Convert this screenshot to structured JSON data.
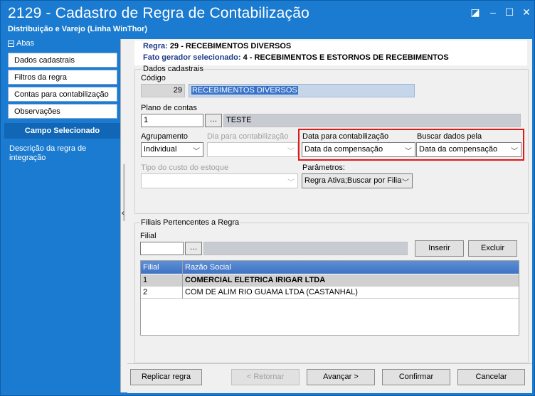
{
  "window": {
    "title": "2129 - Cadastro de Regra de Contabilização",
    "subtitle": "Distribuição e Varejo (Linha WinThor)",
    "controls": {
      "restore": "◪",
      "minimize": "–",
      "maximize": "☐",
      "close": "✕"
    }
  },
  "sidebar": {
    "header": "Abas",
    "items": [
      {
        "label": "Dados cadastrais"
      },
      {
        "label": "Filtros da regra"
      },
      {
        "label": "Contas para contabilização"
      },
      {
        "label": "Observações"
      }
    ],
    "campo_title": "Campo Selecionado",
    "campo_desc": "Descrição da regra de integração"
  },
  "header": {
    "regra_label": "Regra:",
    "regra_value": "29 - RECEBIMENTOS DIVERSOS",
    "fato_label": "Fato gerador selecionado:",
    "fato_value": "4 - RECEBIMENTOS E ESTORNOS DE RECEBIMENTOS"
  },
  "dados": {
    "group_title": "Dados cadastrais",
    "codigo_label": "Código",
    "codigo_value": "29",
    "descricao_value": "RECEBIMENTOS DIVERSOS",
    "plano_label": "Plano de contas",
    "plano_value": "1",
    "plano_desc": "TESTE",
    "agrupamento_label": "Agrupamento",
    "agrupamento_value": "Individual",
    "dia_label": "Dia para contabilização",
    "dia_value": "",
    "data_contab_label": "Data para contabilização",
    "data_contab_value": "Data da compensação",
    "buscar_label": "Buscar dados pela",
    "buscar_value": "Data da compensação",
    "tipo_custo_label": "Tipo do custo do estoque",
    "tipo_custo_value": "",
    "parametros_label": "Parâmetros:",
    "parametros_value": "Regra Ativa;Buscar por Filia"
  },
  "filiais": {
    "group_title": "Filiais Pertencentes a Regra",
    "filial_label": "Filial",
    "filial_value": "",
    "inserir": "Inserir",
    "excluir": "Excluir",
    "columns": [
      "Filial",
      "Razão Social"
    ],
    "rows": [
      {
        "filial": "1",
        "razao": "COMERCIAL ELETRICA IRIGAR LTDA"
      },
      {
        "filial": "2",
        "razao": "COM DE ALIM RIO GUAMA LTDA (CASTANHAL)"
      }
    ]
  },
  "footer": {
    "replicar": "Replicar regra",
    "retornar": "< Retornar",
    "avancar": "Avançar >",
    "confirmar": "Confirmar",
    "cancelar": "Cancelar"
  }
}
